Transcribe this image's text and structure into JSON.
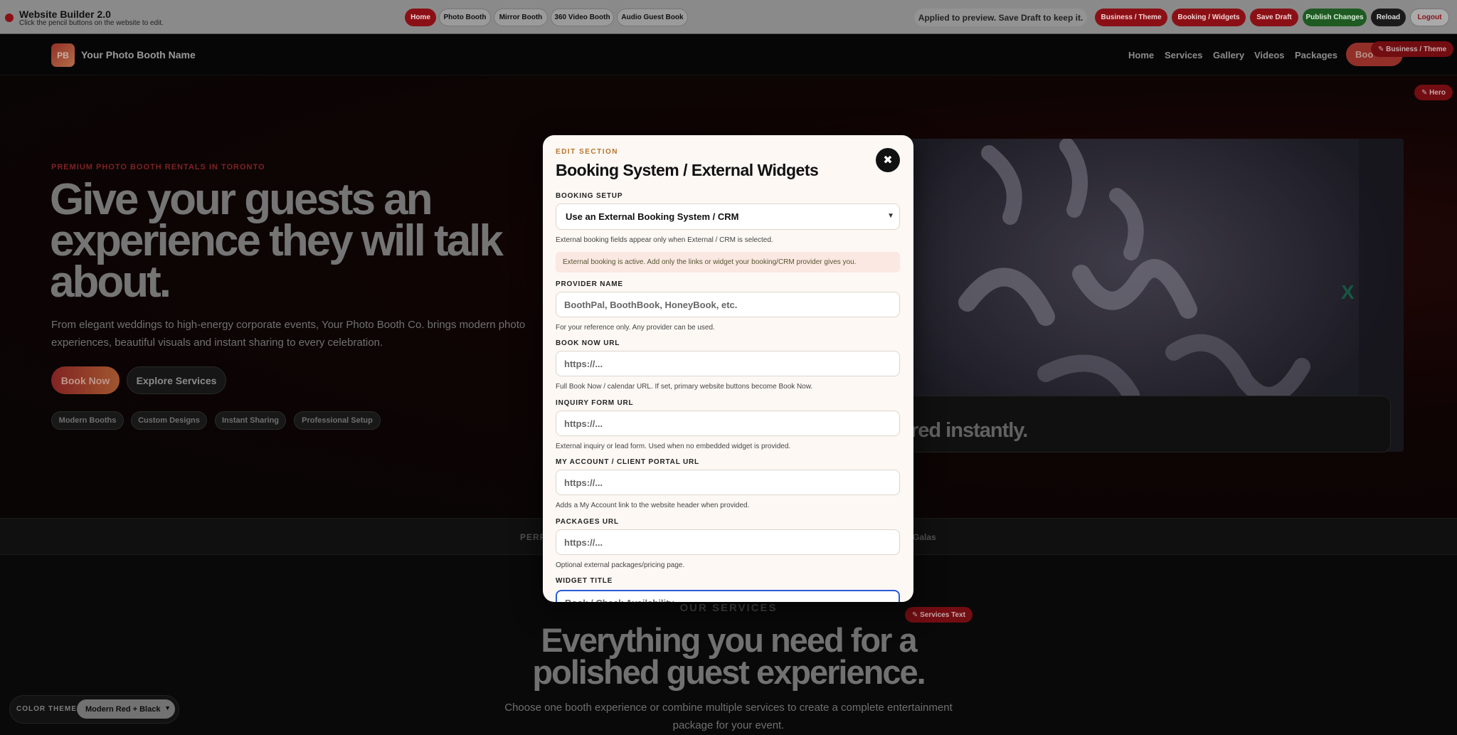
{
  "builder": {
    "title": "Website Builder 2.0",
    "subtitle": "Click the pencil buttons on the website to edit.",
    "tabs": [
      "Home",
      "Photo Booth",
      "Mirror Booth",
      "360 Video Booth",
      "Audio Guest Book"
    ],
    "notice": "Applied to preview. Save Draft to keep it.",
    "actions": {
      "business_theme": "Business / Theme",
      "booking_widgets": "Booking / Widgets",
      "save_draft": "Save Draft",
      "publish": "Publish Changes",
      "reload": "Reload",
      "logout": "Logout"
    }
  },
  "site": {
    "logo_initials": "PB",
    "logo_name": "Your Photo Booth Name",
    "nav": [
      "Home",
      "Services",
      "Gallery",
      "Videos",
      "Packages"
    ],
    "nav_book": "Boo",
    "edit_business": "✎ Business / Theme",
    "edit_hero": "✎ Hero",
    "edit_services": "✎ Services Text"
  },
  "hero": {
    "kicker": "PREMIUM PHOTO BOOTH RENTALS IN TORONTO",
    "title": "Give your guests an experience they will talk about.",
    "description": "From elegant weddings to high-energy corporate events, Your Photo Booth Co. brings modern photo experiences, beautiful visuals and instant sharing to every celebration.",
    "book_now": "Book Now",
    "explore": "Explore Services",
    "chips": [
      "Modern Booths",
      "Custom Designs",
      "Instant Sharing",
      "Professional Setup"
    ],
    "media_caption": "red instantly.",
    "media_mark": "X"
  },
  "strip": {
    "left": "PERF",
    "right": "Galas"
  },
  "services": {
    "kicker": "OUR SERVICES",
    "title_line1": "Everything you need for a",
    "title_line2": "polished guest experience.",
    "desc_line1": "Choose one booth experience or combine multiple services to create a complete entertainment",
    "desc_line2": "package for your event."
  },
  "theme": {
    "label": "COLOR THEME",
    "selected": "Modern Red + Black"
  },
  "modal": {
    "kicker": "EDIT SECTION",
    "title": "Booking System / External Widgets",
    "close_glyph": "✖",
    "booking_setup_label": "BOOKING SETUP",
    "booking_setup_value": "Use an External Booking System / CRM",
    "booking_setup_help": "External booking fields appear only when External / CRM is selected.",
    "notice": "External booking is active. Add only the links or widget your booking/CRM provider gives you.",
    "fields": [
      {
        "label": "PROVIDER NAME",
        "placeholder": "BoothPal, BoothBook, HoneyBook, etc.",
        "help": "For your reference only. Any provider can be used."
      },
      {
        "label": "BOOK NOW URL",
        "placeholder": "https://...",
        "help": "Full Book Now / calendar URL. If set, primary website buttons become Book Now."
      },
      {
        "label": "INQUIRY FORM URL",
        "placeholder": "https://...",
        "help": "External inquiry or lead form. Used when no embedded widget is provided."
      },
      {
        "label": "MY ACCOUNT / CLIENT PORTAL URL",
        "placeholder": "https://...",
        "help": "Adds a My Account link to the website header when provided."
      },
      {
        "label": "PACKAGES URL",
        "placeholder": "https://...",
        "help": "Optional external packages/pricing page."
      }
    ],
    "widget_title_label": "WIDGET TITLE",
    "widget_title_placeholder": "Book / Check Availability"
  }
}
